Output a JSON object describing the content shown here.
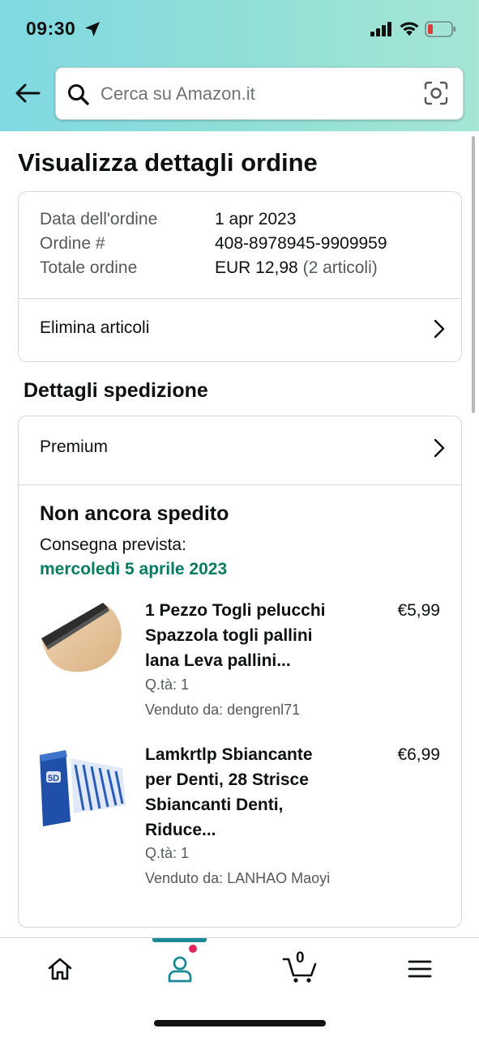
{
  "status_bar": {
    "time": "09:30",
    "location_icon": "location-arrow-icon",
    "signal_icon": "cellular-signal-icon",
    "wifi_icon": "wifi-icon",
    "battery_icon": "battery-low-icon",
    "battery_color": "#e0393e"
  },
  "search": {
    "placeholder": "Cerca su Amazon.it",
    "back_icon": "back-arrow-icon",
    "search_icon": "search-icon",
    "camera_icon": "camera-scan-icon"
  },
  "page": {
    "title": "Visualizza dettagli ordine"
  },
  "order": {
    "rows": [
      {
        "label": "Data dell'ordine",
        "value": "1 apr 2023"
      },
      {
        "label": "Ordine #",
        "value": "408-8978945-9909959"
      },
      {
        "label": "Totale ordine",
        "value": "EUR 12,98",
        "extra": "(2 articoli)"
      }
    ],
    "remove_items_label": "Elimina articoli"
  },
  "shipping": {
    "section_title": "Dettagli spedizione",
    "service": "Premium",
    "status": "Non ancora spedito",
    "expected_label": "Consegna prevista:",
    "expected_date": "mercoledì 5 aprile 2023",
    "date_color": "#067d62",
    "items": [
      {
        "title_lines": [
          "1 Pezzo Togli pelucchi",
          "Spazzola togli pallini",
          "lana Leva pallini..."
        ],
        "price": "€5,99",
        "qty": "Q.tà: 1",
        "seller": "Venduto da: dengrenl71"
      },
      {
        "title_lines": [
          "Lamkrtlp Sbiancante",
          "per Denti, 28 Strisce",
          "Sbiancanti Denti,",
          "Riduce..."
        ],
        "price": "€6,99",
        "qty": "Q.tà: 1",
        "seller": "Venduto da: LANHAO Maoyi"
      }
    ]
  },
  "bottom_nav": {
    "items": [
      "home-icon",
      "account-icon",
      "cart-icon",
      "menu-icon"
    ],
    "cart_count": "0",
    "active_color": "#1b8a96",
    "notification_color": "#e0265a"
  }
}
